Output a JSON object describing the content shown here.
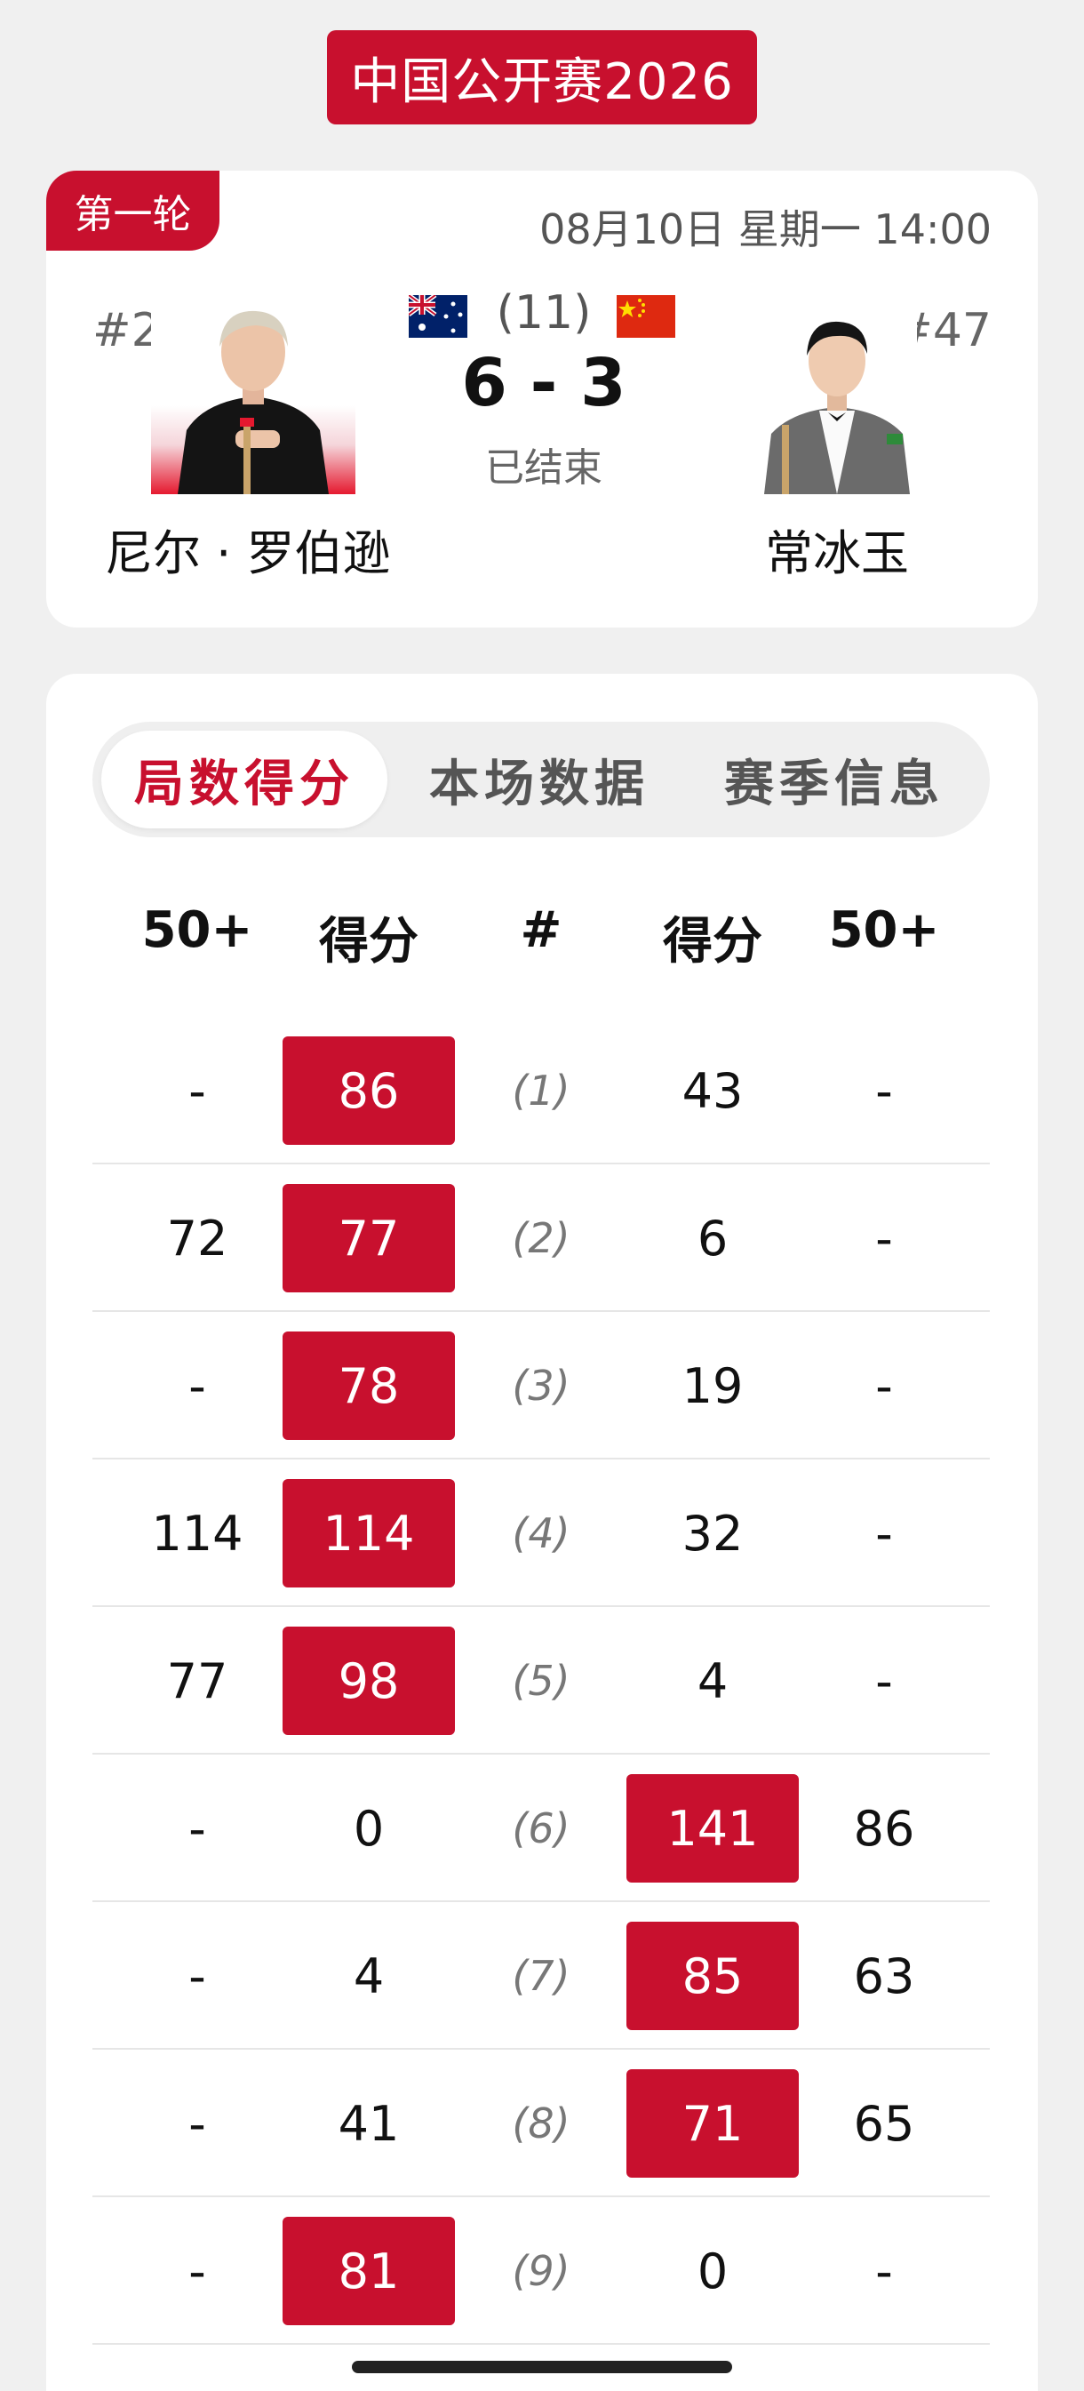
{
  "header": {
    "tournament": "中国公开赛2026"
  },
  "match": {
    "round": "第一轮",
    "datetime": "08月10日 星期一 14:00",
    "left_player": {
      "rank": "#2",
      "name": "尼尔 · 罗伯逊",
      "flag": "australia-flag-icon"
    },
    "right_player": {
      "rank": "#47",
      "name": "常冰玉",
      "flag": "china-flag-icon"
    },
    "best_of": "(11)",
    "score": "6 - 3",
    "status": "已结束"
  },
  "tabs": [
    {
      "label": "局数得分",
      "active": true
    },
    {
      "label": "本场数据",
      "active": false
    },
    {
      "label": "赛季信息",
      "active": false
    }
  ],
  "table": {
    "headers": [
      "50+",
      "得分",
      "#",
      "得分",
      "50+"
    ],
    "rows": [
      {
        "left_break": "-",
        "left_score": "86",
        "frame": "(1)",
        "right_score": "43",
        "right_break": "-",
        "winner": "left"
      },
      {
        "left_break": "72",
        "left_score": "77",
        "frame": "(2)",
        "right_score": "6",
        "right_break": "-",
        "winner": "left"
      },
      {
        "left_break": "-",
        "left_score": "78",
        "frame": "(3)",
        "right_score": "19",
        "right_break": "-",
        "winner": "left"
      },
      {
        "left_break": "114",
        "left_score": "114",
        "frame": "(4)",
        "right_score": "32",
        "right_break": "-",
        "winner": "left"
      },
      {
        "left_break": "77",
        "left_score": "98",
        "frame": "(5)",
        "right_score": "4",
        "right_break": "-",
        "winner": "left"
      },
      {
        "left_break": "-",
        "left_score": "0",
        "frame": "(6)",
        "right_score": "141",
        "right_break": "86",
        "winner": "right"
      },
      {
        "left_break": "-",
        "left_score": "4",
        "frame": "(7)",
        "right_score": "85",
        "right_break": "63",
        "winner": "right"
      },
      {
        "left_break": "-",
        "left_score": "41",
        "frame": "(8)",
        "right_score": "71",
        "right_break": "65",
        "winner": "right"
      },
      {
        "left_break": "-",
        "left_score": "81",
        "frame": "(9)",
        "right_score": "0",
        "right_break": "-",
        "winner": "left"
      }
    ]
  },
  "colors": {
    "accent": "#c8102e",
    "background": "#f0f0f0",
    "card": "#ffffff"
  }
}
